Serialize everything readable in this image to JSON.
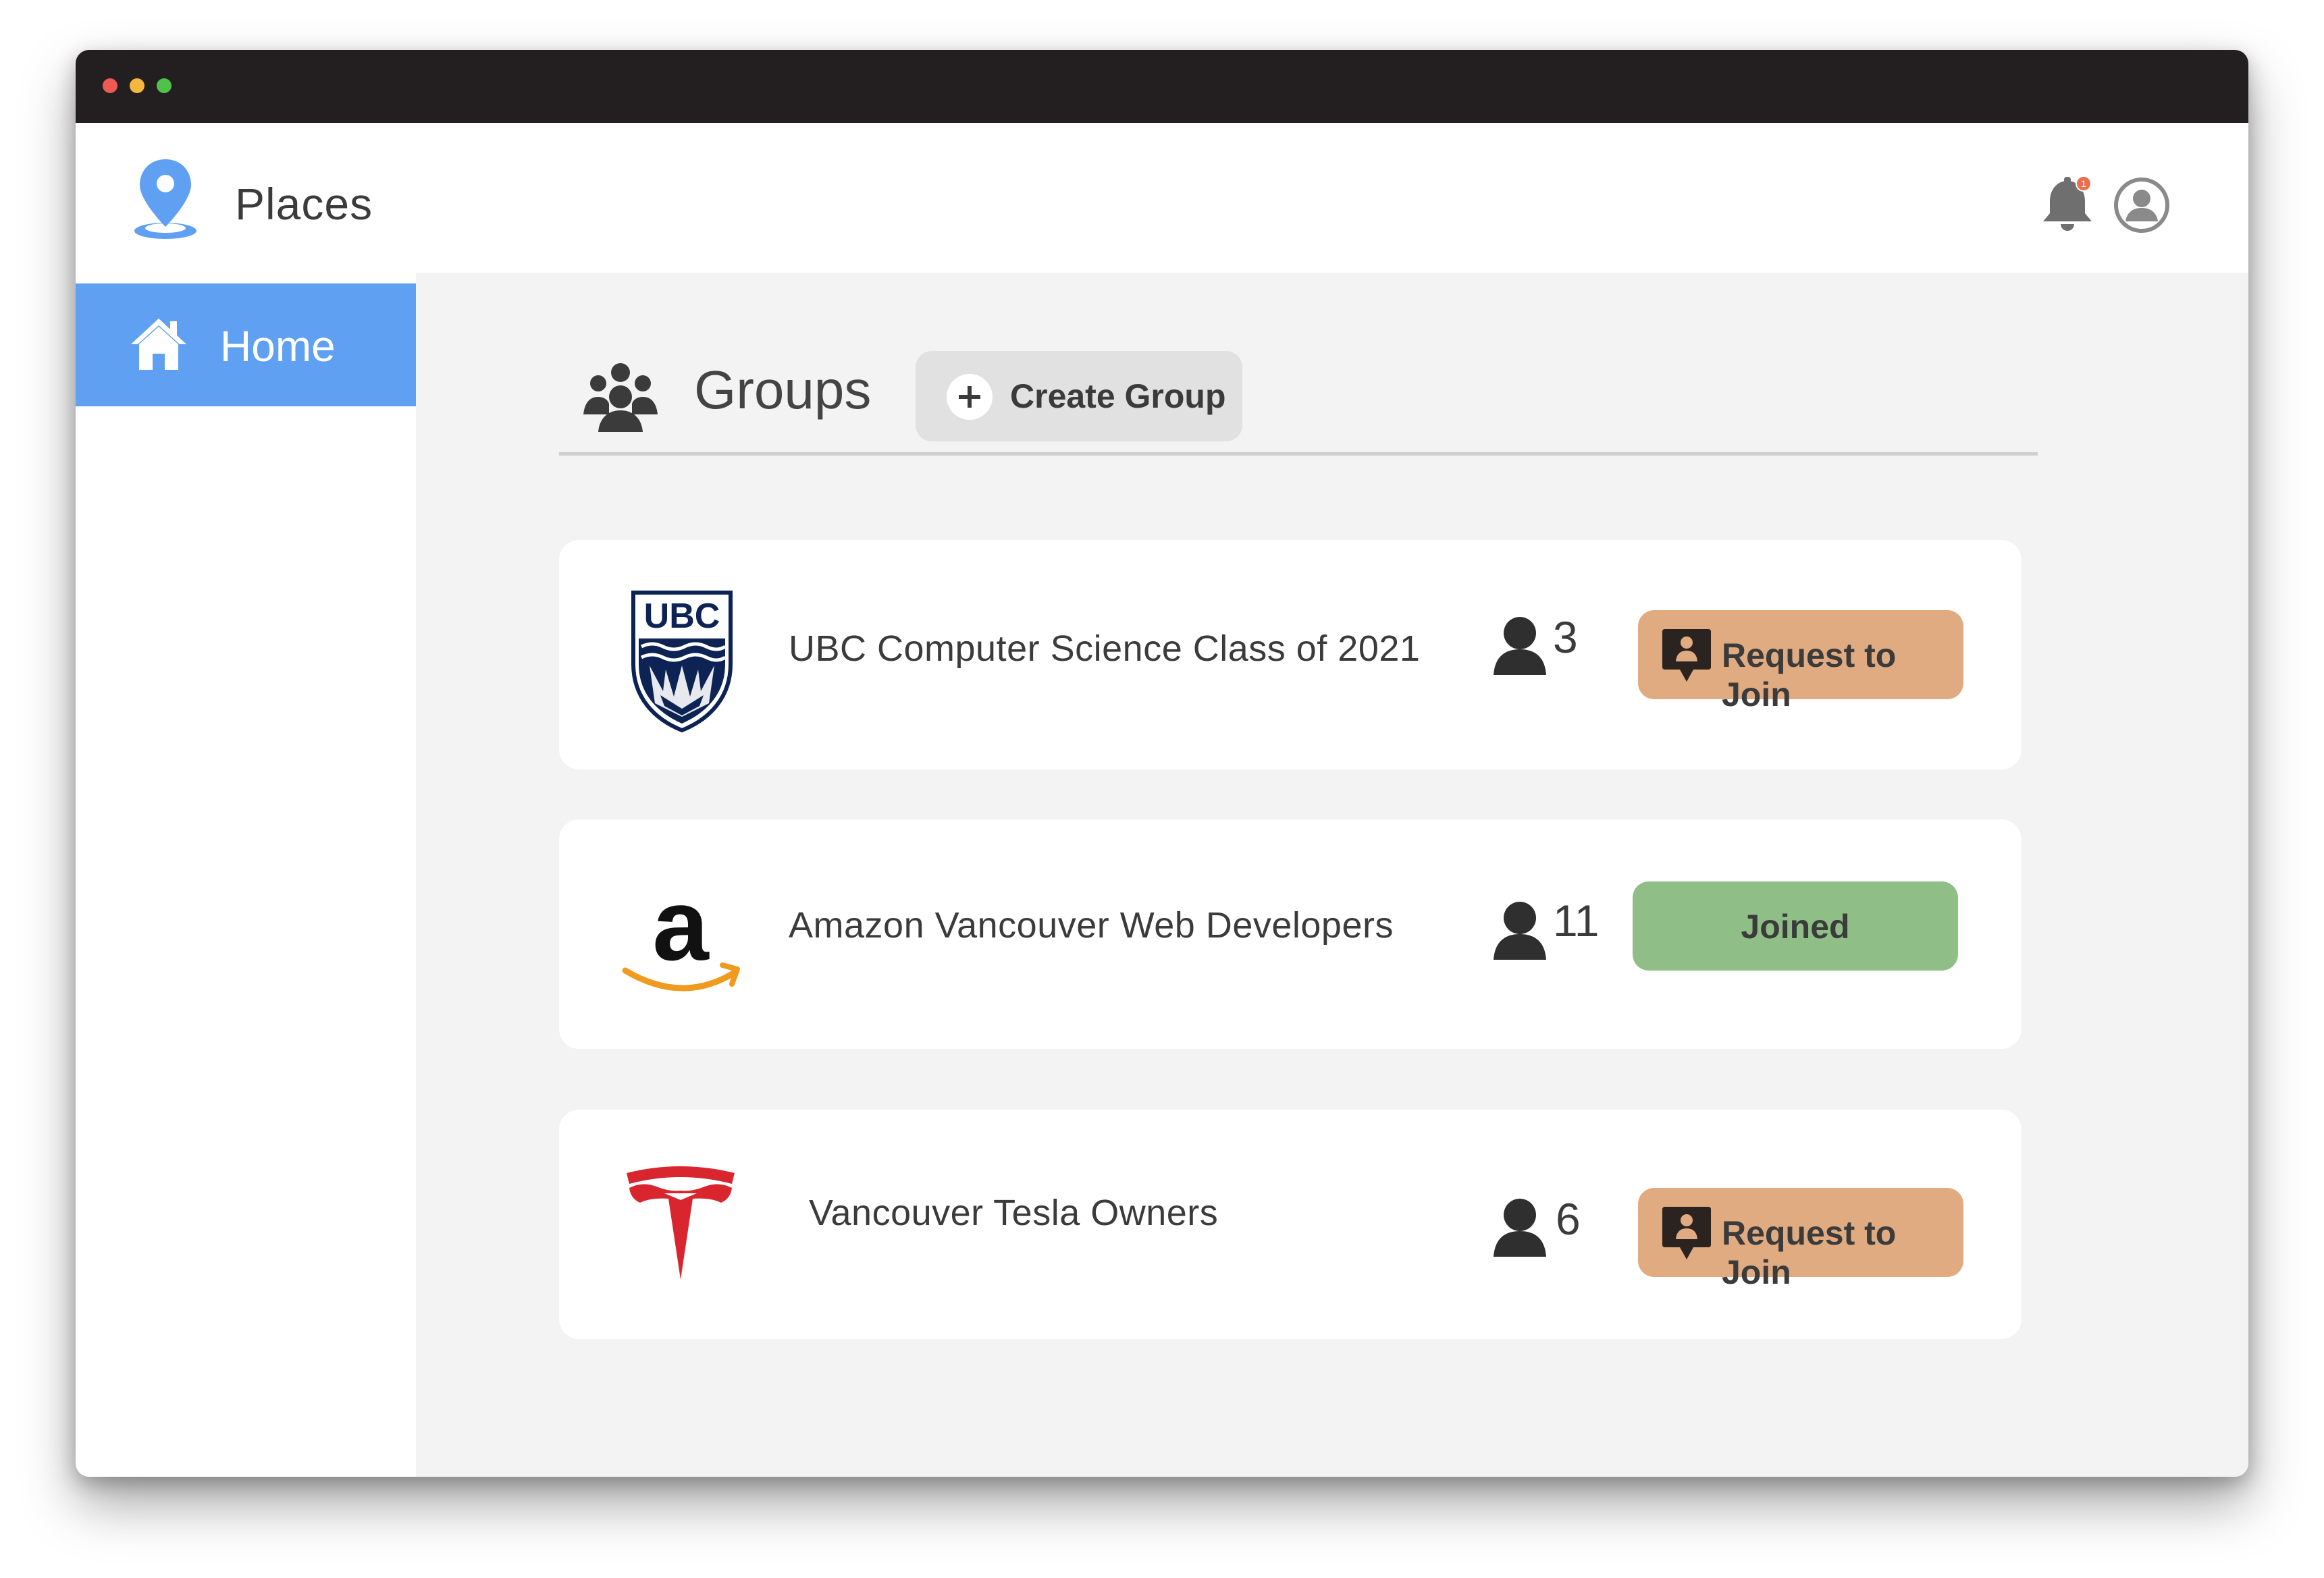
{
  "app": {
    "title": "Places",
    "notification_count": "1",
    "accent_color": "#60a0f2"
  },
  "sidebar": {
    "items": [
      {
        "label": "Home",
        "icon": "home-icon",
        "active": true
      }
    ]
  },
  "groups_section": {
    "title": "Groups",
    "create_button_label": "Create Group",
    "groups": [
      {
        "name": "UBC Computer Science Class of 2021",
        "logo": "ubc-logo",
        "logo_text": "UBC",
        "members": "3",
        "action_label": "Request to Join",
        "status": "not-joined"
      },
      {
        "name": "Amazon Vancouver Web Developers",
        "logo": "amazon-logo",
        "logo_text": "a",
        "members": "11",
        "action_label": "Joined",
        "status": "joined"
      },
      {
        "name": "Vancouver Tesla Owners",
        "logo": "tesla-logo",
        "members": "6",
        "action_label": "Request to Join",
        "status": "not-joined"
      }
    ]
  },
  "colors": {
    "request_button": "#e1ab82",
    "joined_button": "#8fbf86",
    "background": "#f3f3f3"
  }
}
